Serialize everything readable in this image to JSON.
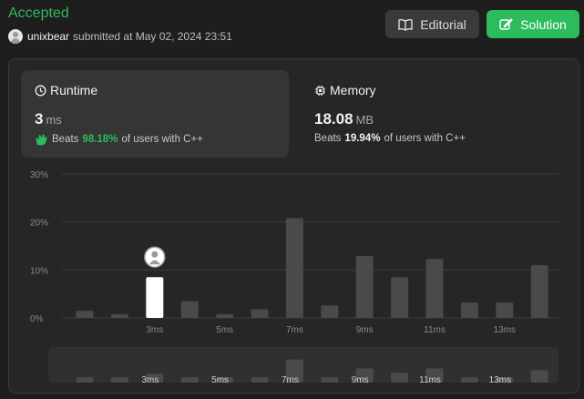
{
  "header": {
    "status": "Accepted",
    "username": "unixbear",
    "submitted_text": "submitted at May 02, 2024 23:51"
  },
  "buttons": {
    "editorial_label": "Editorial",
    "solution_label": "Solution"
  },
  "runtime": {
    "title": "Runtime",
    "value": "3",
    "unit": "ms",
    "beats_prefix": "Beats",
    "beats_percent": "98.18%",
    "beats_suffix": "of users with C++"
  },
  "memory": {
    "title": "Memory",
    "value": "18.08",
    "unit": "MB",
    "beats_prefix": "Beats",
    "beats_percent": "19.94%",
    "beats_suffix": "of users with C++"
  },
  "colors": {
    "accent": "#2cbb5d",
    "bar": "#4a4a4a",
    "highlight_bar": "#ffffff"
  },
  "icons": {
    "editorial": "book-icon",
    "solution": "edit-icon",
    "runtime": "clock-icon",
    "memory": "chip-icon",
    "beats": "clap-icon"
  },
  "chart_data": {
    "type": "bar",
    "y_ticks": [
      "30%",
      "20%",
      "10%",
      "0%"
    ],
    "ylim": [
      0,
      30
    ],
    "x_tick_labels": [
      "3ms",
      "5ms",
      "7ms",
      "9ms",
      "11ms",
      "13ms"
    ],
    "x_tick_indices": [
      3,
      5,
      7,
      9,
      11,
      13
    ],
    "x": [
      1,
      2,
      3,
      4,
      5,
      6,
      7,
      8,
      9,
      10,
      11,
      12,
      13,
      14
    ],
    "values": [
      1.5,
      0.8,
      8.5,
      3.5,
      0.8,
      1.8,
      20.8,
      2.6,
      12.9,
      8.5,
      12.3,
      3.2,
      3.2,
      11.0
    ],
    "highlight_x": 3,
    "navigator_values": [
      1.5,
      1.5,
      2.5,
      1.5,
      1.5,
      1.5,
      6.5,
      1.5,
      4.0,
      2.8,
      4.0,
      1.5,
      1.5,
      3.5
    ]
  }
}
